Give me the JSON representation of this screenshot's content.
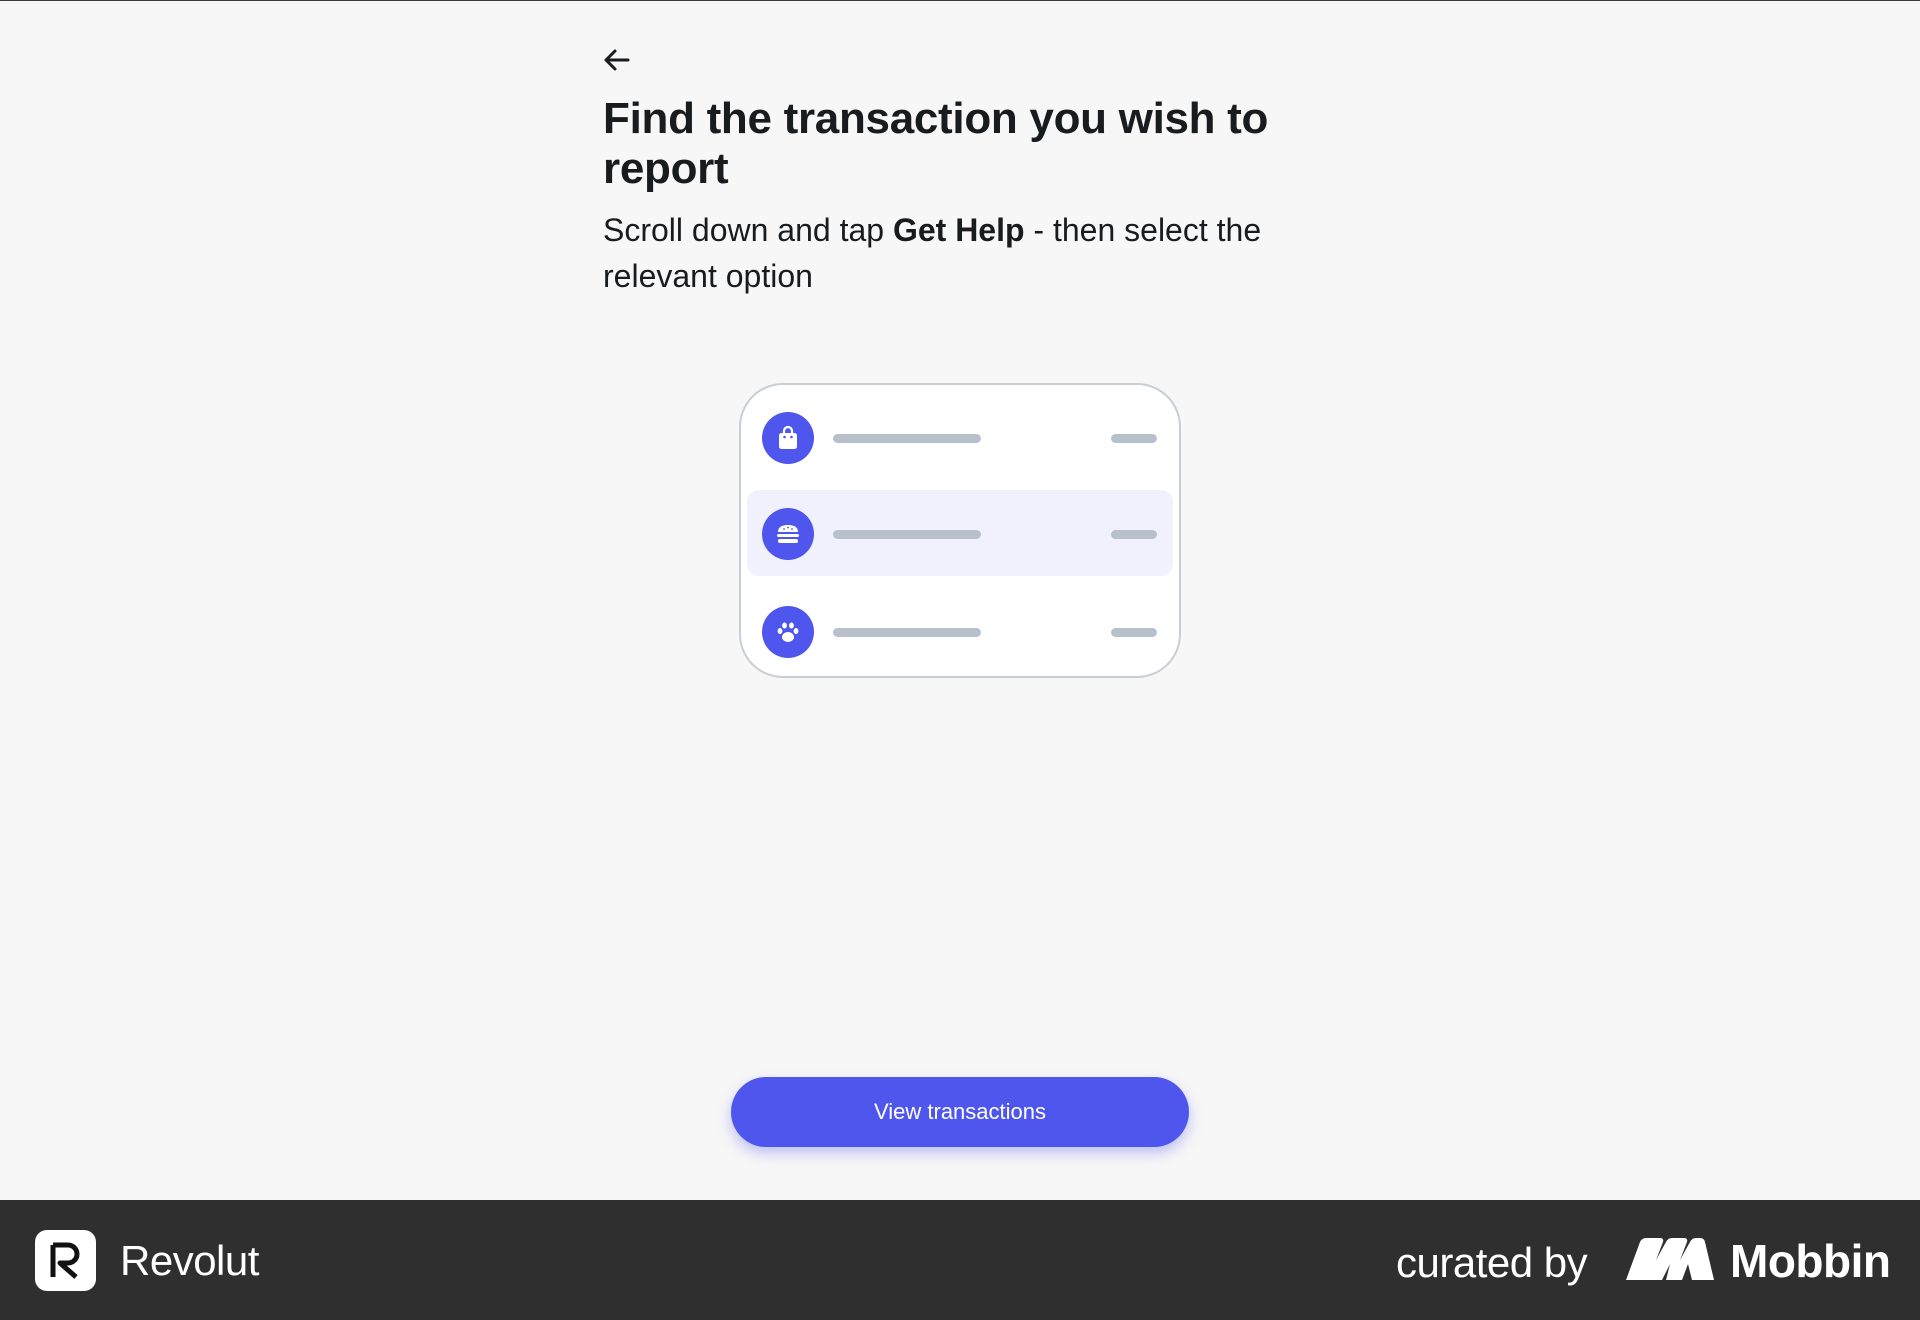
{
  "screen": {
    "title": "Find the transaction you wish to report",
    "subtitle_pre": "Scroll down and tap ",
    "subtitle_bold": "Get Help",
    "subtitle_post": " - then select the relevant option"
  },
  "nav": {
    "back_icon": "arrow-left-icon"
  },
  "illustration": {
    "rows": [
      {
        "icon": "shopping-bag-icon",
        "highlighted": false
      },
      {
        "icon": "burger-icon",
        "highlighted": true
      },
      {
        "icon": "paw-icon",
        "highlighted": false
      }
    ]
  },
  "actions": {
    "view_transactions_label": "View transactions"
  },
  "footer": {
    "app_name": "Revolut",
    "curated_label": "curated by",
    "curator_name": "Mobbin"
  },
  "colors": {
    "accent": "#4f56ee",
    "background": "#f7f7f7",
    "footer": "#2f2f2f",
    "placeholder_bar": "#b8c0cb",
    "highlight_row": "#f0f1fd"
  }
}
